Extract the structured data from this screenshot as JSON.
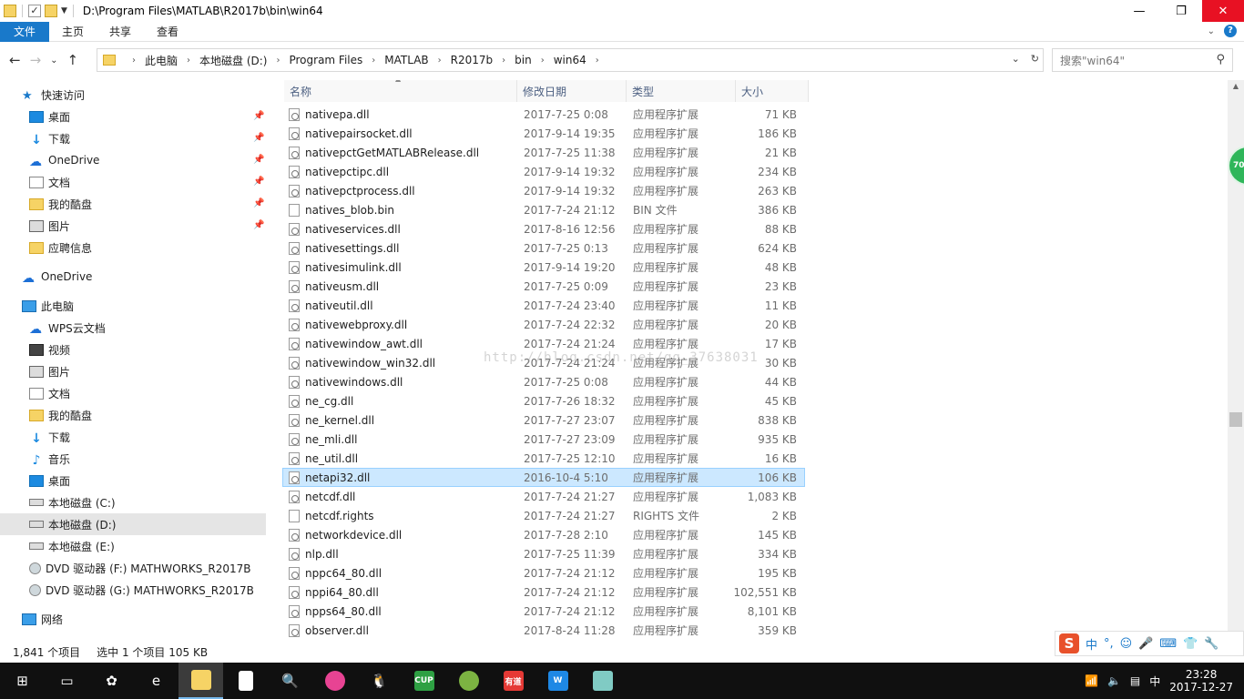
{
  "window": {
    "title": "D:\\Program Files\\MATLAB\\R2017b\\bin\\win64"
  },
  "ribbon": {
    "tabs": [
      "文件",
      "主页",
      "共享",
      "查看"
    ]
  },
  "address": {
    "crumbs": [
      "此电脑",
      "本地磁盘 (D:)",
      "Program Files",
      "MATLAB",
      "R2017b",
      "bin",
      "win64"
    ]
  },
  "search": {
    "placeholder": "搜索\"win64\""
  },
  "nav": {
    "quick_access": "快速访问",
    "quick_items": [
      "桌面",
      "下载",
      "OneDrive",
      "文档",
      "我的酷盘",
      "图片",
      "应聘信息"
    ],
    "onedrive": "OneDrive",
    "this_pc": "此电脑",
    "pc_items": [
      "WPS云文档",
      "视频",
      "图片",
      "文档",
      "我的酷盘",
      "下载",
      "音乐",
      "桌面",
      "本地磁盘 (C:)",
      "本地磁盘 (D:)",
      "本地磁盘 (E:)",
      "DVD 驱动器 (F:) MATHWORKS_R2017B",
      "DVD 驱动器 (G:) MATHWORKS_R2017B"
    ],
    "network": "网络"
  },
  "columns": {
    "name": "名称",
    "date": "修改日期",
    "type": "类型",
    "size": "大小"
  },
  "files": [
    {
      "name": "nativepa.dll",
      "date": "2017-7-25 0:08",
      "type": "应用程序扩展",
      "size": "71 KB"
    },
    {
      "name": "nativepairsocket.dll",
      "date": "2017-9-14 19:35",
      "type": "应用程序扩展",
      "size": "186 KB"
    },
    {
      "name": "nativepctGetMATLABRelease.dll",
      "date": "2017-7-25 11:38",
      "type": "应用程序扩展",
      "size": "21 KB"
    },
    {
      "name": "nativepctipc.dll",
      "date": "2017-9-14 19:32",
      "type": "应用程序扩展",
      "size": "234 KB"
    },
    {
      "name": "nativepctprocess.dll",
      "date": "2017-9-14 19:32",
      "type": "应用程序扩展",
      "size": "263 KB"
    },
    {
      "name": "natives_blob.bin",
      "date": "2017-7-24 21:12",
      "type": "BIN 文件",
      "size": "386 KB"
    },
    {
      "name": "nativeservices.dll",
      "date": "2017-8-16 12:56",
      "type": "应用程序扩展",
      "size": "88 KB"
    },
    {
      "name": "nativesettings.dll",
      "date": "2017-7-25 0:13",
      "type": "应用程序扩展",
      "size": "624 KB"
    },
    {
      "name": "nativesimulink.dll",
      "date": "2017-9-14 19:20",
      "type": "应用程序扩展",
      "size": "48 KB"
    },
    {
      "name": "nativeusm.dll",
      "date": "2017-7-25 0:09",
      "type": "应用程序扩展",
      "size": "23 KB"
    },
    {
      "name": "nativeutil.dll",
      "date": "2017-7-24 23:40",
      "type": "应用程序扩展",
      "size": "11 KB"
    },
    {
      "name": "nativewebproxy.dll",
      "date": "2017-7-24 22:32",
      "type": "应用程序扩展",
      "size": "20 KB"
    },
    {
      "name": "nativewindow_awt.dll",
      "date": "2017-7-24 21:24",
      "type": "应用程序扩展",
      "size": "17 KB"
    },
    {
      "name": "nativewindow_win32.dll",
      "date": "2017-7-24 21:24",
      "type": "应用程序扩展",
      "size": "30 KB"
    },
    {
      "name": "nativewindows.dll",
      "date": "2017-7-25 0:08",
      "type": "应用程序扩展",
      "size": "44 KB"
    },
    {
      "name": "ne_cg.dll",
      "date": "2017-7-26 18:32",
      "type": "应用程序扩展",
      "size": "45 KB"
    },
    {
      "name": "ne_kernel.dll",
      "date": "2017-7-27 23:07",
      "type": "应用程序扩展",
      "size": "838 KB"
    },
    {
      "name": "ne_mli.dll",
      "date": "2017-7-27 23:09",
      "type": "应用程序扩展",
      "size": "935 KB"
    },
    {
      "name": "ne_util.dll",
      "date": "2017-7-25 12:10",
      "type": "应用程序扩展",
      "size": "16 KB"
    },
    {
      "name": "netapi32.dll",
      "date": "2016-10-4 5:10",
      "type": "应用程序扩展",
      "size": "106 KB"
    },
    {
      "name": "netcdf.dll",
      "date": "2017-7-24 21:27",
      "type": "应用程序扩展",
      "size": "1,083 KB"
    },
    {
      "name": "netcdf.rights",
      "date": "2017-7-24 21:27",
      "type": "RIGHTS 文件",
      "size": "2 KB"
    },
    {
      "name": "networkdevice.dll",
      "date": "2017-7-28 2:10",
      "type": "应用程序扩展",
      "size": "145 KB"
    },
    {
      "name": "nlp.dll",
      "date": "2017-7-25 11:39",
      "type": "应用程序扩展",
      "size": "334 KB"
    },
    {
      "name": "nppc64_80.dll",
      "date": "2017-7-24 21:12",
      "type": "应用程序扩展",
      "size": "195 KB"
    },
    {
      "name": "nppi64_80.dll",
      "date": "2017-7-24 21:12",
      "type": "应用程序扩展",
      "size": "102,551 KB"
    },
    {
      "name": "npps64_80.dll",
      "date": "2017-7-24 21:12",
      "type": "应用程序扩展",
      "size": "8,101 KB"
    },
    {
      "name": "observer.dll",
      "date": "2017-8-24 11:28",
      "type": "应用程序扩展",
      "size": "359 KB"
    }
  ],
  "selected_file": "netapi32.dll",
  "watermark": "http://blog.csdn.net/qq_37638031",
  "status": {
    "count": "1,841 个项目",
    "selected": "选中 1 个项目  105 KB"
  },
  "side_badge": "70",
  "taskbar": {
    "time": "23:28",
    "date": "2017-12-27",
    "ime": "中"
  }
}
